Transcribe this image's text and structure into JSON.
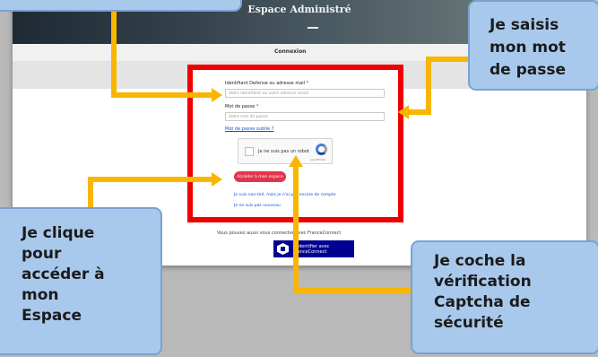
{
  "page": {
    "header_title": "Espace Administré",
    "tab_label": "Connexion"
  },
  "form": {
    "id_label": "Identifiant Defense ou adresse mail",
    "id_required": "*",
    "id_placeholder": "Votre identifiant ou votre adresse email",
    "password_label": "Mot de passe",
    "password_required": "*",
    "password_placeholder": "Votre mot de passe",
    "forgot_link": "Mot de passe oublié ?",
    "captcha_text": "Je ne suis pas un robot",
    "captcha_small": "reCAPTCHA",
    "login_button": "Accéder à mon espace",
    "link_lost_id": "Je suis non-tiré, mais je n'ai pas encore de compte",
    "link_blocked": "Je ne suis pas nouveau"
  },
  "franceconnect": {
    "intro": "Vous pouvez aussi vous connecter avec FranceConnect",
    "button_line1": "S'identifier avec",
    "button_line2": "FranceConnect"
  },
  "callouts": {
    "password": [
      "Je saisis",
      "mon mot",
      "de passe"
    ],
    "click": [
      "Je clique",
      "pour",
      "accéder à",
      "mon",
      "Espace"
    ],
    "captcha": [
      "Je coche la",
      "vérification",
      "Captcha de",
      "sécurité"
    ]
  },
  "colors": {
    "frame_red": "#ef0000",
    "arrow_yellow": "#f9b600",
    "callout_blue": "#a9c9ec",
    "login_button": "#e2344c",
    "franceconnect_blue": "#000091"
  },
  "icons": {
    "captcha": "recaptcha-icon",
    "franceconnect": "franceconnect-logo-icon"
  }
}
